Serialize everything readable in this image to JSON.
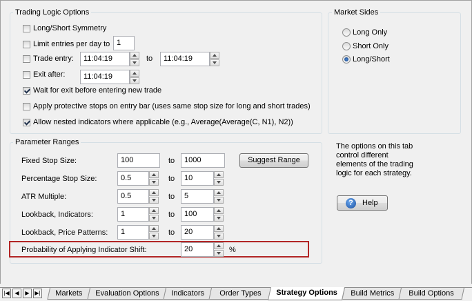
{
  "trading_logic": {
    "title": "Trading Logic Options",
    "long_short_symmetry": {
      "label": "Long/Short Symmetry",
      "checked": false
    },
    "limit_entries": {
      "label": "Limit entries per day to",
      "checked": false,
      "value": "1"
    },
    "trade_entry": {
      "label": "Trade entry:",
      "checked": false,
      "from": "11:04:19",
      "to_label": "to",
      "to": "11:04:19"
    },
    "exit_after": {
      "label": "Exit after:",
      "checked": false,
      "value": "11:04:19"
    },
    "wait_for_exit": {
      "label": "Wait for exit before entering new trade",
      "checked": true
    },
    "protective_stops": {
      "label": "Apply protective stops on entry bar (uses same stop size for long and short trades)",
      "checked": false
    },
    "nested_indicators": {
      "label": "Allow nested indicators where applicable (e.g., Average(Average(C, N1), N2))",
      "checked": true
    }
  },
  "market_sides": {
    "title": "Market Sides",
    "options": [
      {
        "label": "Long Only",
        "selected": false
      },
      {
        "label": "Short Only",
        "selected": false
      },
      {
        "label": "Long/Short",
        "selected": true
      }
    ]
  },
  "parameter_ranges": {
    "title": "Parameter Ranges",
    "to_label": "to",
    "suggest_button": "Suggest Range",
    "fixed_stop": {
      "label": "Fixed Stop Size:",
      "from": "100",
      "to": "1000"
    },
    "percentage_stop": {
      "label": "Percentage Stop Size:",
      "from": "0.5",
      "to": "10"
    },
    "atr_multiple": {
      "label": "ATR Multiple:",
      "from": "0.5",
      "to": "5"
    },
    "lookback_indicators": {
      "label": "Lookback, Indicators:",
      "from": "1",
      "to": "100"
    },
    "lookback_price": {
      "label": "Lookback, Price Patterns:",
      "from": "1",
      "to": "20"
    },
    "indicator_shift": {
      "label": "Probability of Applying Indicator Shift:",
      "value": "20",
      "unit": "%"
    }
  },
  "info": {
    "text": "The options on this tab control different elements of the trading logic for each strategy.",
    "help_button": "Help"
  },
  "tabs": [
    {
      "label": "Markets",
      "active": false
    },
    {
      "label": "Evaluation Options",
      "active": false
    },
    {
      "label": "Indicators",
      "active": false
    },
    {
      "label": "Order Types",
      "active": false
    },
    {
      "label": "Strategy Options",
      "active": true
    },
    {
      "label": "Build Metrics",
      "active": false
    },
    {
      "label": "Build Options",
      "active": false
    }
  ],
  "nav_icons": [
    "first-icon",
    "prev-icon",
    "next-icon",
    "last-icon"
  ],
  "colors": {
    "highlight": "#b22525",
    "background": "#f0f0f0"
  }
}
